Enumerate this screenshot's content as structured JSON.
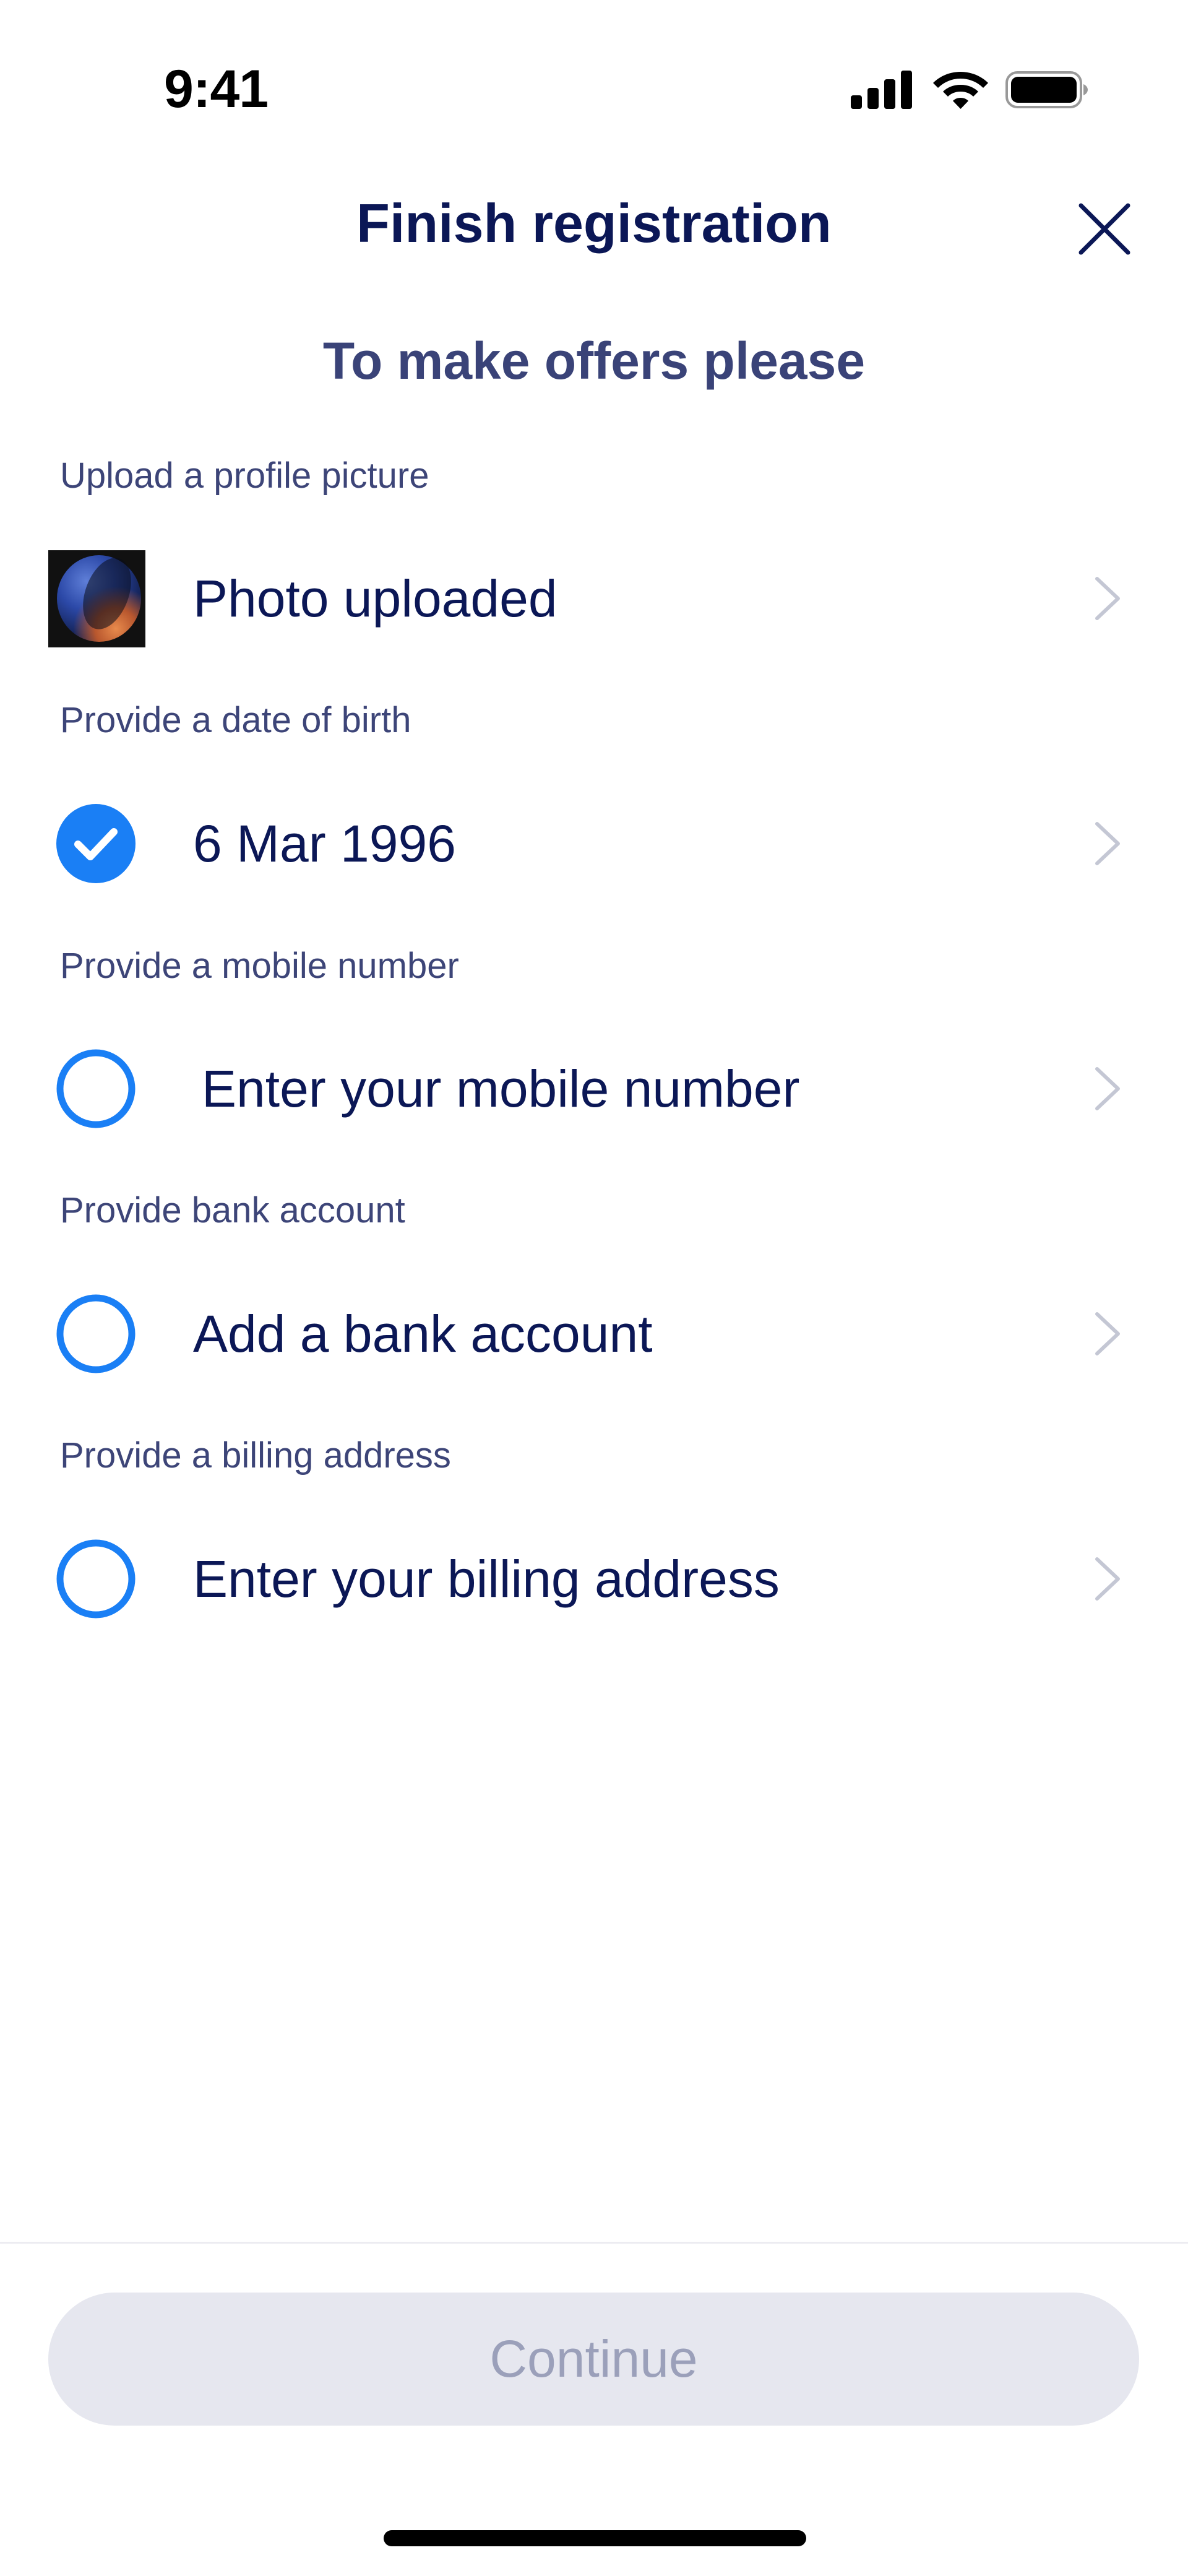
{
  "status_bar": {
    "time": "9:41",
    "icons": [
      "signal-icon",
      "wifi-icon",
      "battery-icon"
    ]
  },
  "header": {
    "title": "Finish registration",
    "close_icon": "close-icon"
  },
  "subtitle": "To make offers please",
  "sections": [
    {
      "label": "Upload a profile picture",
      "value": "Photo uploaded",
      "status": "photo",
      "chevron": "chevron-right-icon"
    },
    {
      "label": "Provide a date of birth",
      "value": "6 Mar 1996",
      "status": "complete",
      "chevron": "chevron-right-icon"
    },
    {
      "label": "Provide a mobile number",
      "value": "Enter your mobile number",
      "status": "incomplete",
      "chevron": "chevron-right-icon"
    },
    {
      "label": "Provide bank account",
      "value": "Add a bank account",
      "status": "incomplete",
      "chevron": "chevron-right-icon"
    },
    {
      "label": "Provide a billing address",
      "value": "Enter your billing address",
      "status": "incomplete",
      "chevron": "chevron-right-icon"
    }
  ],
  "footer": {
    "continue_label": "Continue",
    "continue_enabled": false
  },
  "colors": {
    "primary_text": "#0b1756",
    "accent_blue": "#1a7ff5",
    "label_text": "#3d4578",
    "disabled_button_bg": "#e6e7ef",
    "disabled_button_text": "#9ba0ba",
    "chevron": "#c4c7d4"
  }
}
